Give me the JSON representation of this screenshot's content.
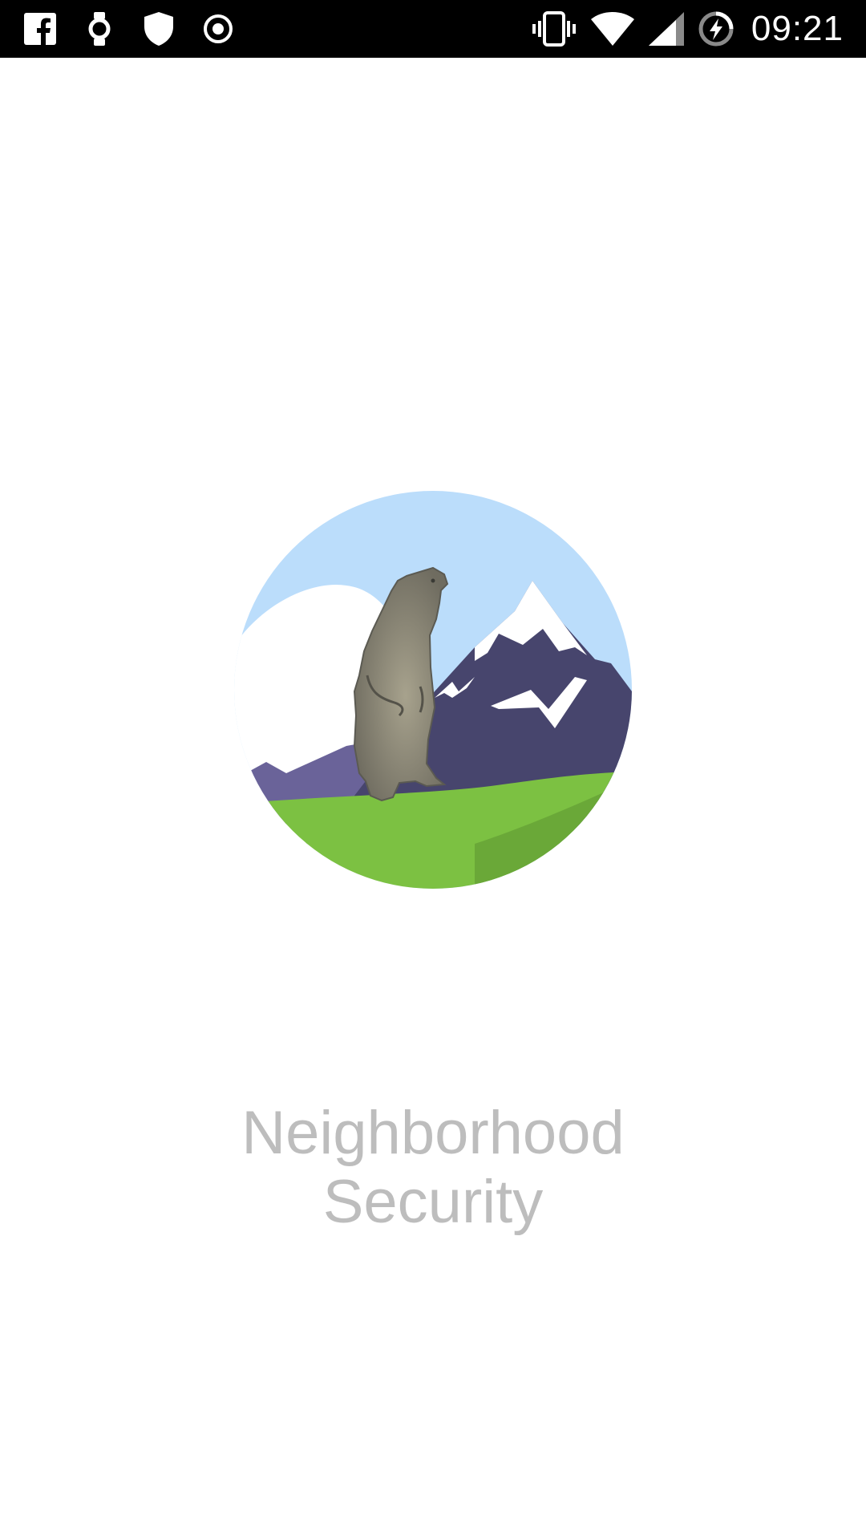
{
  "status_bar": {
    "time": "09:21",
    "left_icons": [
      "facebook-icon",
      "smartwatch-icon",
      "shield-icon",
      "radio-target-icon"
    ],
    "right_icons": [
      "vibrate-icon",
      "wifi-icon",
      "cell-signal-icon",
      "battery-charging-icon"
    ]
  },
  "splash": {
    "logo": "marmot-mountain-logo",
    "title_line1": "Neighborhood",
    "title_line2": "Security"
  }
}
